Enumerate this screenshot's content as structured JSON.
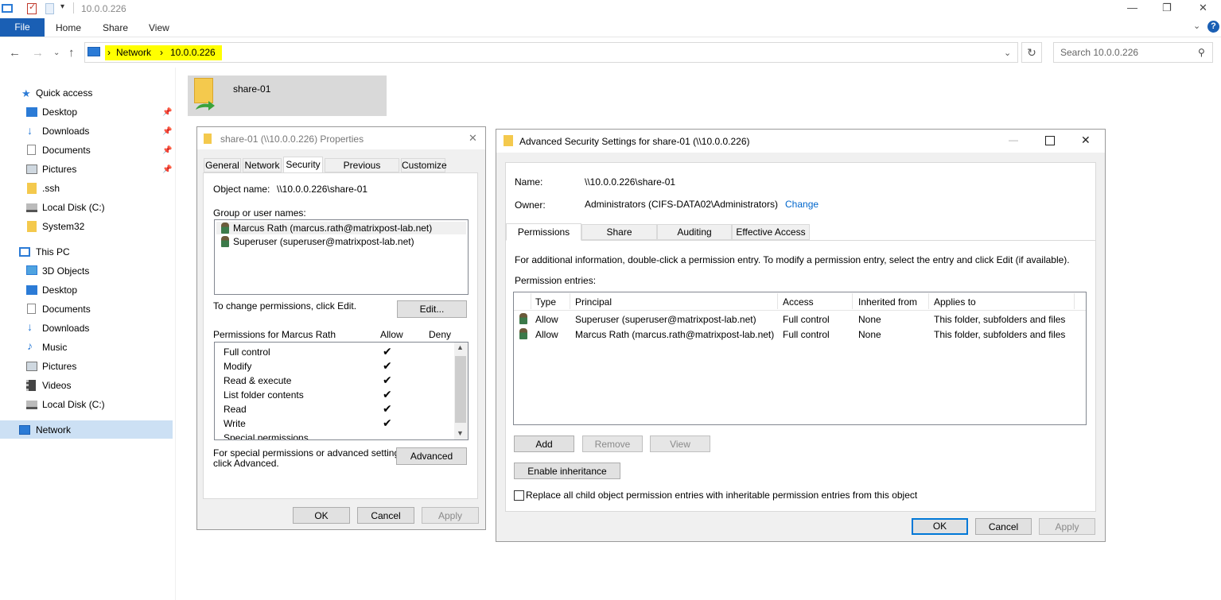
{
  "window": {
    "title": "10.0.0.226"
  },
  "ribbon": {
    "file": "File",
    "tabs": [
      "Home",
      "Share",
      "View"
    ]
  },
  "address": {
    "crumbs": [
      "Network",
      "10.0.0.226"
    ],
    "search_placeholder": "Search 10.0.0.226"
  },
  "nav": {
    "quick_access": "Quick access",
    "quick_items": [
      "Desktop",
      "Downloads",
      "Documents",
      "Pictures",
      ".ssh",
      "Local Disk (C:)",
      "System32"
    ],
    "this_pc": "This PC",
    "pc_items": [
      "3D Objects",
      "Desktop",
      "Documents",
      "Downloads",
      "Music",
      "Pictures",
      "Videos",
      "Local Disk (C:)"
    ],
    "network": "Network"
  },
  "content": {
    "folder": "share-01"
  },
  "props": {
    "title": "share-01 (\\\\10.0.0.226) Properties",
    "tabs": [
      "General",
      "Network",
      "Security",
      "Previous Versions",
      "Customize"
    ],
    "object_name_label": "Object name:",
    "object_name": "\\\\10.0.0.226\\share-01",
    "group_label": "Group or user names:",
    "users": [
      "Marcus Rath (marcus.rath@matrixpost-lab.net)",
      "Superuser (superuser@matrixpost-lab.net)"
    ],
    "change_text": "To change permissions, click Edit.",
    "edit_btn": "Edit...",
    "perm_for": "Permissions for Marcus Rath",
    "allow": "Allow",
    "deny": "Deny",
    "perms": [
      "Full control",
      "Modify",
      "Read & execute",
      "List folder contents",
      "Read",
      "Write",
      "Special permissions"
    ],
    "special_text_1": "For special permissions or advanced settings,",
    "special_text_2": "click Advanced.",
    "advanced_btn": "Advanced",
    "ok": "OK",
    "cancel": "Cancel",
    "apply": "Apply"
  },
  "adv": {
    "title": "Advanced Security Settings for share-01 (\\\\10.0.0.226)",
    "name_label": "Name:",
    "name_value": "\\\\10.0.0.226\\share-01",
    "owner_label": "Owner:",
    "owner_value": "Administrators (CIFS-DATA02\\Administrators)",
    "change_link": "Change",
    "tabs": [
      "Permissions",
      "Share",
      "Auditing",
      "Effective Access"
    ],
    "info": "For additional information, double-click a permission entry. To modify a permission entry, select the entry and click Edit (if available).",
    "entries_label": "Permission entries:",
    "columns": [
      "Type",
      "Principal",
      "Access",
      "Inherited from",
      "Applies to"
    ],
    "rows": [
      [
        "Allow",
        "Superuser (superuser@matrixpost-lab.net)",
        "Full control",
        "None",
        "This folder, subfolders and files"
      ],
      [
        "Allow",
        "Marcus Rath (marcus.rath@matrixpost-lab.net)",
        "Full control",
        "None",
        "This folder, subfolders and files"
      ]
    ],
    "add": "Add",
    "remove": "Remove",
    "view": "View",
    "enable_inheritance": "Enable inheritance",
    "replace_text": "Replace all child object permission entries with inheritable permission entries from this object",
    "ok": "OK",
    "cancel": "Cancel",
    "apply": "Apply"
  }
}
